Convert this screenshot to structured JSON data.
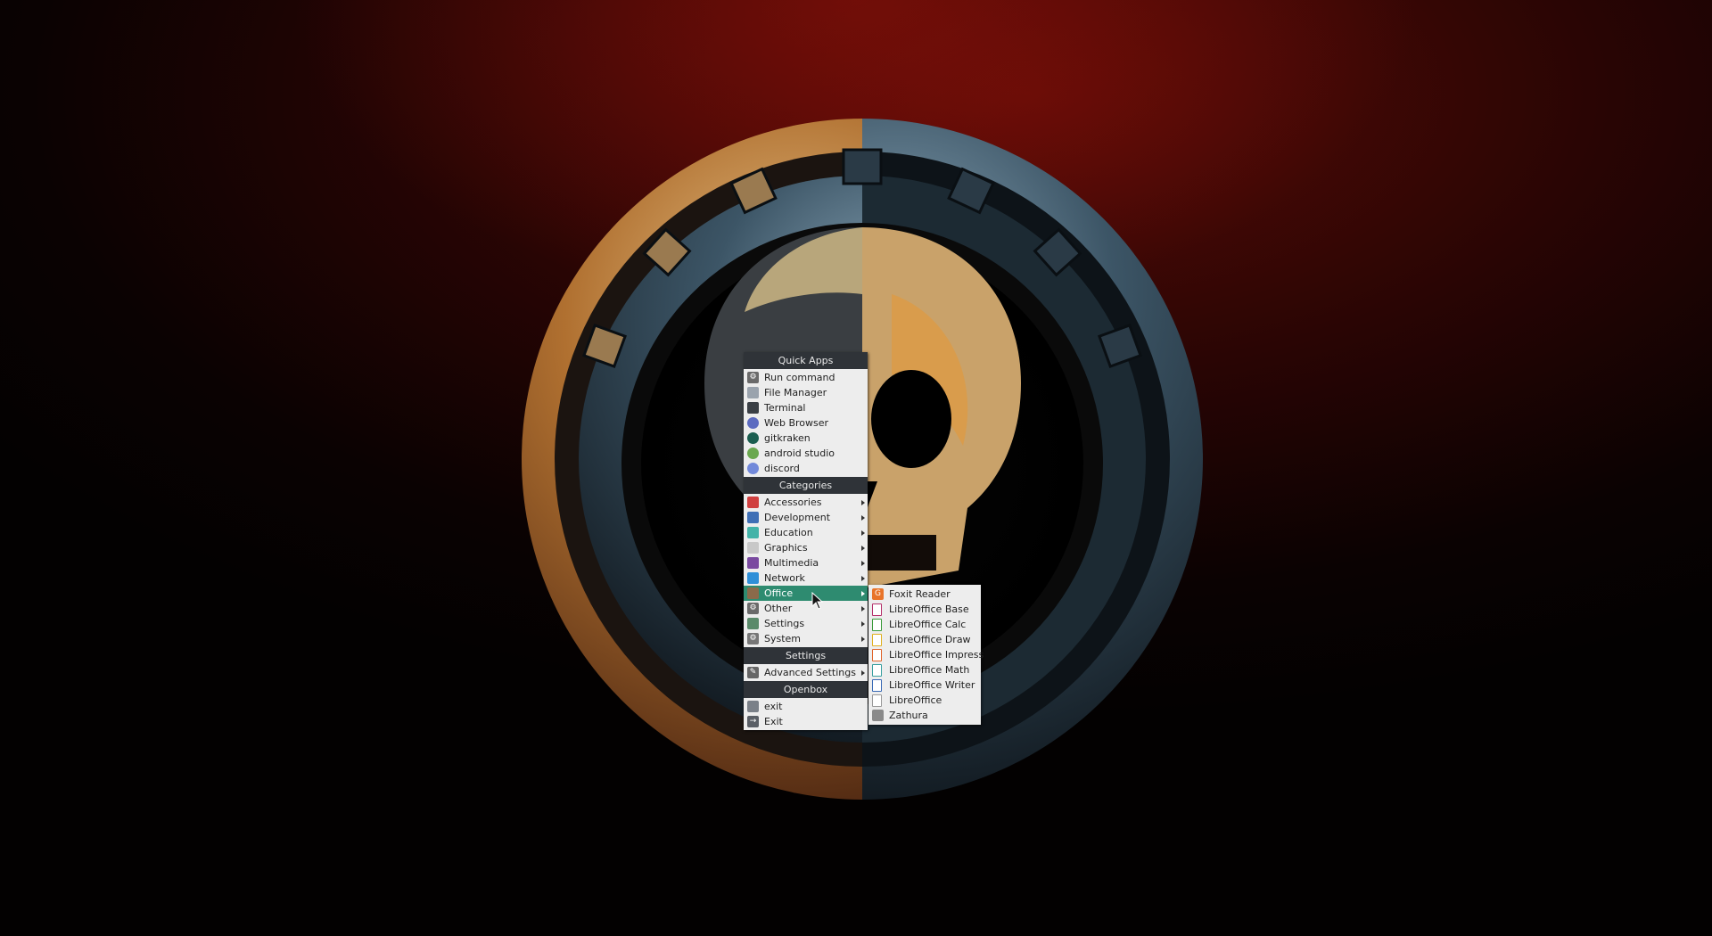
{
  "menu": {
    "quick_apps": {
      "header": "Quick Apps",
      "items": [
        {
          "label": "Run command",
          "icon": "gears-icon",
          "color": "#6a6a6a"
        },
        {
          "label": "File Manager",
          "icon": "folder-icon",
          "color": "#9aa3ad"
        },
        {
          "label": "Terminal",
          "icon": "terminal-icon",
          "color": "#3a3f45"
        },
        {
          "label": "Web Browser",
          "icon": "globe-icon",
          "color": "#5c6bc0"
        },
        {
          "label": "gitkraken",
          "icon": "gitkraken-icon",
          "color": "#1b5e50"
        },
        {
          "label": "android studio",
          "icon": "android-studio-icon",
          "color": "#6aa84f"
        },
        {
          "label": "discord",
          "icon": "discord-icon",
          "color": "#7289da"
        }
      ]
    },
    "categories": {
      "header": "Categories",
      "items": [
        {
          "label": "Accessories",
          "icon": "toolbox-icon",
          "color": "#d04040"
        },
        {
          "label": "Development",
          "icon": "development-icon",
          "color": "#3f6fb5"
        },
        {
          "label": "Education",
          "icon": "flask-icon",
          "color": "#43b3a8"
        },
        {
          "label": "Graphics",
          "icon": "palette-icon",
          "color": "#c8c8c8"
        },
        {
          "label": "Multimedia",
          "icon": "multimedia-icon",
          "color": "#7a4aa0"
        },
        {
          "label": "Network",
          "icon": "cloud-icon",
          "color": "#2e8fd8"
        },
        {
          "label": "Office",
          "icon": "briefcase-icon",
          "color": "#8a6a4a",
          "active": true
        },
        {
          "label": "Other",
          "icon": "gear-icon",
          "color": "#6a6a6a"
        },
        {
          "label": "Settings",
          "icon": "settings-icon",
          "color": "#5a8a6a"
        },
        {
          "label": "System",
          "icon": "system-gear-icon",
          "color": "#777777"
        }
      ]
    },
    "settings": {
      "header": "Settings",
      "items": [
        {
          "label": "Advanced Settings",
          "icon": "wrench-icon",
          "color": "#666666"
        }
      ]
    },
    "openbox": {
      "header": "Openbox",
      "items": [
        {
          "label": "exit",
          "icon": "logout-icon",
          "color": "#7a8088"
        },
        {
          "label": "Exit",
          "icon": "exit-icon",
          "color": "#5a5f66"
        }
      ]
    }
  },
  "office_submenu": {
    "items": [
      {
        "label": "Foxit Reader",
        "icon": "foxit-reader-icon",
        "color": "#e8742a"
      },
      {
        "label": "LibreOffice Base",
        "icon": "libreoffice-base-icon",
        "color": "#b5306a"
      },
      {
        "label": "LibreOffice Calc",
        "icon": "libreoffice-calc-icon",
        "color": "#3a9a3a"
      },
      {
        "label": "LibreOffice Draw",
        "icon": "libreoffice-draw-icon",
        "color": "#e0b020"
      },
      {
        "label": "LibreOffice Impress",
        "icon": "libreoffice-impress-icon",
        "color": "#e0642a"
      },
      {
        "label": "LibreOffice Math",
        "icon": "libreoffice-math-icon",
        "color": "#3aa0a0"
      },
      {
        "label": "LibreOffice Writer",
        "icon": "libreoffice-writer-icon",
        "color": "#3a6ab5"
      },
      {
        "label": "LibreOffice",
        "icon": "libreoffice-icon",
        "color": "#9a9a9a"
      },
      {
        "label": "Zathura",
        "icon": "zathura-icon",
        "color": "#8a8a8a"
      }
    ]
  }
}
